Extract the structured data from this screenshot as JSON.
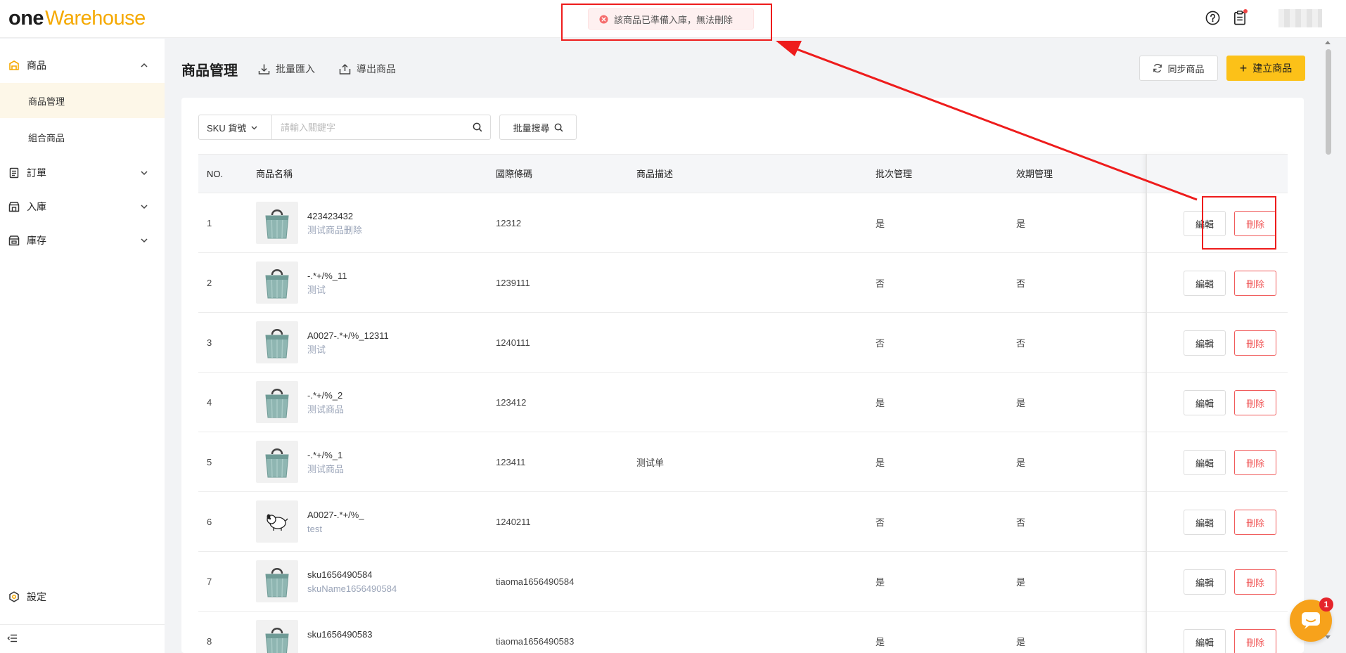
{
  "header": {
    "logo_one": "one",
    "logo_warehouse": "Warehouse",
    "help_icon": "question-circle-icon",
    "notes_icon": "clipboard-icon"
  },
  "toast": {
    "message": "該商品已準備入庫，無法刪除",
    "icon": "error-circle-icon",
    "color": "#f56c6c"
  },
  "sidebar": {
    "groups": [
      {
        "label": "商品",
        "icon": "product-icon",
        "expanded": true
      },
      {
        "label": "訂單",
        "icon": "order-icon",
        "expanded": false
      },
      {
        "label": "入庫",
        "icon": "inbound-icon",
        "expanded": false
      },
      {
        "label": "庫存",
        "icon": "inventory-icon",
        "expanded": false
      }
    ],
    "sub_items": [
      {
        "label": "商品管理",
        "active": true
      },
      {
        "label": "組合商品",
        "active": false
      }
    ],
    "settings_label": "設定"
  },
  "page": {
    "title": "商品管理",
    "bulk_import": "批量匯入",
    "export": "導出商品",
    "sync": "同步商品",
    "create": "建立商品"
  },
  "search": {
    "sku_select": "SKU 貨號",
    "placeholder": "請輸入關鍵字",
    "bulk_search": "批量搜尋"
  },
  "table": {
    "columns": [
      "NO.",
      "商品名稱",
      "國際條碼",
      "商品描述",
      "批次管理",
      "效期管理"
    ],
    "edit_label": "編輯",
    "delete_label": "刪除",
    "rows": [
      {
        "no": "1",
        "name": "423423432",
        "sub": "测试商品删除",
        "barcode": "12312",
        "desc": "",
        "batch": "是",
        "expiry": "是",
        "thumb": "bag"
      },
      {
        "no": "2",
        "name": "-.*+/%_11",
        "sub": "测试",
        "barcode": "1239111",
        "desc": "",
        "batch": "否",
        "expiry": "否",
        "thumb": "bag"
      },
      {
        "no": "3",
        "name": "A0027-.*+/%_12311",
        "sub": "测试",
        "barcode": "1240111",
        "desc": "",
        "batch": "否",
        "expiry": "否",
        "thumb": "bag"
      },
      {
        "no": "4",
        "name": "-.*+/%_2",
        "sub": "测试商品",
        "barcode": "123412",
        "desc": "",
        "batch": "是",
        "expiry": "是",
        "thumb": "bag"
      },
      {
        "no": "5",
        "name": "-.*+/%_1",
        "sub": "测试商品",
        "barcode": "123411",
        "desc": "测试单",
        "batch": "是",
        "expiry": "是",
        "thumb": "bag"
      },
      {
        "no": "6",
        "name": "A0027-.*+/%_",
        "sub": "test",
        "barcode": "1240211",
        "desc": "",
        "batch": "否",
        "expiry": "否",
        "thumb": "dog"
      },
      {
        "no": "7",
        "name": "sku1656490584",
        "sub": "skuName1656490584",
        "barcode": "tiaoma1656490584",
        "desc": "",
        "batch": "是",
        "expiry": "是",
        "thumb": "bag"
      },
      {
        "no": "8",
        "name": "sku1656490583",
        "sub": "",
        "barcode": "tiaoma1656490583",
        "desc": "",
        "batch": "是",
        "expiry": "是",
        "thumb": "bag"
      }
    ]
  },
  "chat": {
    "badge": "1",
    "icon": "chat-bubble-icon"
  },
  "colors": {
    "accent": "#fcc118",
    "danger": "#f05b5b",
    "annotation": "#ee1c1c"
  }
}
